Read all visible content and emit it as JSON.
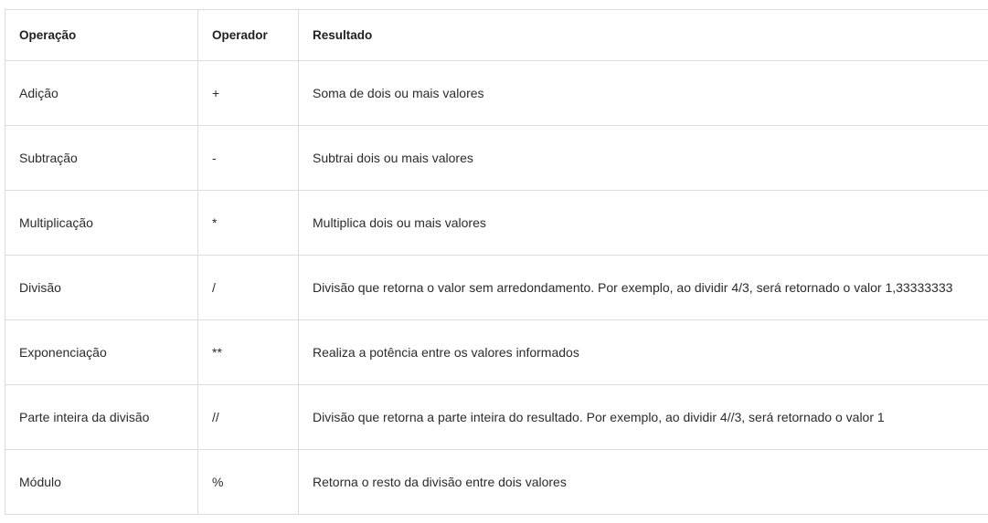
{
  "table": {
    "headers": [
      "Operação",
      "Operador",
      "Resultado"
    ],
    "rows": [
      [
        "Adição",
        "+",
        "Soma de dois ou mais valores"
      ],
      [
        "Subtração",
        "-",
        "Subtrai dois ou mais valores"
      ],
      [
        "Multiplicação",
        "*",
        "Multiplica dois ou mais valores"
      ],
      [
        "Divisão",
        "/",
        "Divisão que retorna o valor sem arredondamento. Por exemplo, ao dividir 4/3, será retornado o valor 1,33333333"
      ],
      [
        "Exponenciação",
        "**",
        "Realiza a potência entre os valores informados"
      ],
      [
        "Parte inteira da divisão",
        "//",
        "Divisão que retorna a parte inteira do resultado. Por exemplo, ao dividir 4//3, será retornado o valor 1"
      ],
      [
        "Módulo",
        "%",
        "Retorna o resto da divisão entre dois valores"
      ]
    ]
  }
}
